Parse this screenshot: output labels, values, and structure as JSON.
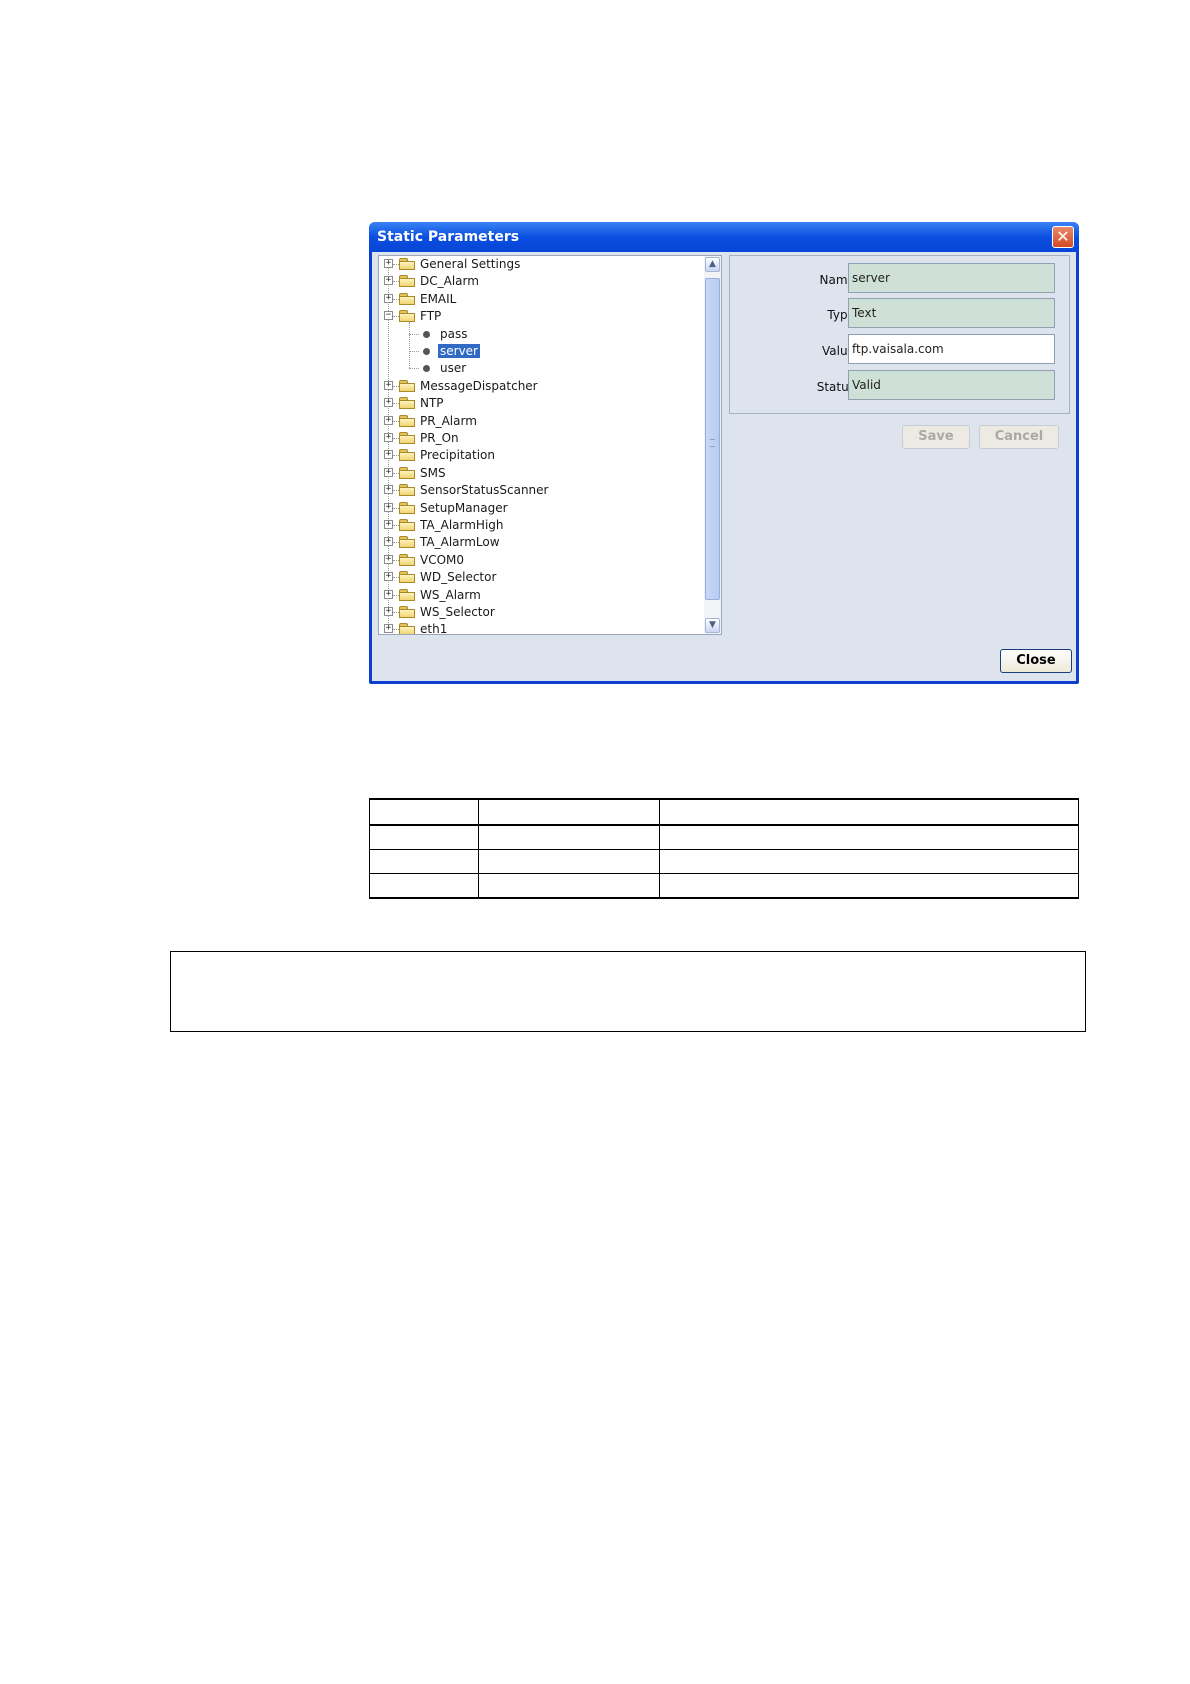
{
  "dialog": {
    "title": "Static Parameters",
    "close_glyph": "✕"
  },
  "tree": {
    "items": [
      {
        "label": "General Settings",
        "type": "folder",
        "expanded": false
      },
      {
        "label": "DC_Alarm",
        "type": "folder",
        "expanded": false
      },
      {
        "label": "EMAIL",
        "type": "folder",
        "expanded": false
      },
      {
        "label": "FTP",
        "type": "folder",
        "expanded": true
      },
      {
        "label": "pass",
        "type": "leaf"
      },
      {
        "label": "server",
        "type": "leaf",
        "selected": true
      },
      {
        "label": "user",
        "type": "leaf"
      },
      {
        "label": "MessageDispatcher",
        "type": "folder",
        "expanded": false
      },
      {
        "label": "NTP",
        "type": "folder",
        "expanded": false
      },
      {
        "label": "PR_Alarm",
        "type": "folder",
        "expanded": false
      },
      {
        "label": "PR_On",
        "type": "folder",
        "expanded": false
      },
      {
        "label": "Precipitation",
        "type": "folder",
        "expanded": false
      },
      {
        "label": "SMS",
        "type": "folder",
        "expanded": false
      },
      {
        "label": "SensorStatusScanner",
        "type": "folder",
        "expanded": false
      },
      {
        "label": "SetupManager",
        "type": "folder",
        "expanded": false
      },
      {
        "label": "TA_AlarmHigh",
        "type": "folder",
        "expanded": false
      },
      {
        "label": "TA_AlarmLow",
        "type": "folder",
        "expanded": false
      },
      {
        "label": "VCOM0",
        "type": "folder",
        "expanded": false
      },
      {
        "label": "WD_Selector",
        "type": "folder",
        "expanded": false
      },
      {
        "label": "WS_Alarm",
        "type": "folder",
        "expanded": false
      },
      {
        "label": "WS_Selector",
        "type": "folder",
        "expanded": false
      },
      {
        "label": "eth1",
        "type": "folder",
        "expanded": false
      }
    ]
  },
  "properties": {
    "name_label": "Name:",
    "name_value": "server",
    "type_label": "Type:",
    "type_value": "Text",
    "value_label": "Value:",
    "value_value": "ftp.vaisala.com",
    "status_label": "Status:",
    "status_value": "Valid"
  },
  "buttons": {
    "save": "Save",
    "cancel": "Cancel",
    "close": "Close"
  },
  "colors": {
    "title_bar": "#0a4fe0",
    "selection": "#316ac5",
    "readonly_field": "#cfe0d7"
  }
}
